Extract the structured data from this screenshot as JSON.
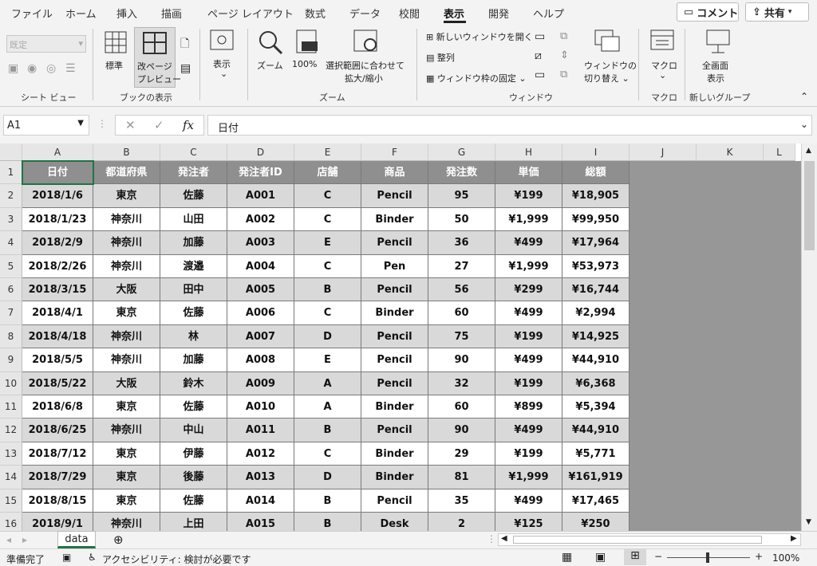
{
  "tabs": [
    "ファイル",
    "ホーム",
    "挿入",
    "描画",
    "ページ レイアウト",
    "数式",
    "データ",
    "校閲",
    "表示",
    "開発",
    "ヘルプ"
  ],
  "active_tab": "表示",
  "top_buttons": {
    "comment": "コメント",
    "share": "共有"
  },
  "ribbon": {
    "sheet_view": {
      "dropdown_value": "既定",
      "label": "シート ビュー"
    },
    "workbook_views": {
      "normal": "標準",
      "page_break_1": "改ページ",
      "page_break_2": "プレビュー",
      "label": "ブックの表示"
    },
    "show": {
      "button": "表示"
    },
    "zoom": {
      "zoom": "ズーム",
      "zoom100": "100%",
      "fit_1": "選択範囲に合わせて",
      "fit_2": "拡大/縮小",
      "label": "ズーム"
    },
    "window": {
      "new_window": "新しいウィンドウを開く",
      "arrange": "整列",
      "freeze": "ウィンドウ枠の固定",
      "switch_1": "ウィンドウの",
      "switch_2": "切り替え",
      "label": "ウィンドウ"
    },
    "macro": {
      "button": "マクロ",
      "label": "マクロ"
    },
    "new_group": {
      "btn_1": "全画面",
      "btn_2": "表示",
      "label": "新しいグループ"
    }
  },
  "formula_bar": {
    "name_box": "A1",
    "formula": "日付"
  },
  "columns": [
    "A",
    "B",
    "C",
    "D",
    "E",
    "F",
    "G",
    "H",
    "I",
    "J",
    "K",
    "L"
  ],
  "rows": [
    "1",
    "2",
    "3",
    "4",
    "5",
    "6",
    "7",
    "8",
    "9",
    "10",
    "11",
    "12",
    "13",
    "14",
    "15",
    "16"
  ],
  "table": {
    "headers": [
      "日付",
      "都道府県",
      "発注者",
      "発注者ID",
      "店舗",
      "商品",
      "発注数",
      "単価",
      "総額"
    ],
    "data": [
      [
        "2018/1/6",
        "東京",
        "佐藤",
        "A001",
        "C",
        "Pencil",
        "95",
        "¥199",
        "¥18,905"
      ],
      [
        "2018/1/23",
        "神奈川",
        "山田",
        "A002",
        "C",
        "Binder",
        "50",
        "¥1,999",
        "¥99,950"
      ],
      [
        "2018/2/9",
        "神奈川",
        "加藤",
        "A003",
        "E",
        "Pencil",
        "36",
        "¥499",
        "¥17,964"
      ],
      [
        "2018/2/26",
        "神奈川",
        "渡邉",
        "A004",
        "C",
        "Pen",
        "27",
        "¥1,999",
        "¥53,973"
      ],
      [
        "2018/3/15",
        "大阪",
        "田中",
        "A005",
        "B",
        "Pencil",
        "56",
        "¥299",
        "¥16,744"
      ],
      [
        "2018/4/1",
        "東京",
        "佐藤",
        "A006",
        "C",
        "Binder",
        "60",
        "¥499",
        "¥2,994"
      ],
      [
        "2018/4/18",
        "神奈川",
        "林",
        "A007",
        "D",
        "Pencil",
        "75",
        "¥199",
        "¥14,925"
      ],
      [
        "2018/5/5",
        "神奈川",
        "加藤",
        "A008",
        "E",
        "Pencil",
        "90",
        "¥499",
        "¥44,910"
      ],
      [
        "2018/5/22",
        "大阪",
        "鈴木",
        "A009",
        "A",
        "Pencil",
        "32",
        "¥199",
        "¥6,368"
      ],
      [
        "2018/6/8",
        "東京",
        "佐藤",
        "A010",
        "A",
        "Binder",
        "60",
        "¥899",
        "¥5,394"
      ],
      [
        "2018/6/25",
        "神奈川",
        "中山",
        "A011",
        "B",
        "Pencil",
        "90",
        "¥499",
        "¥44,910"
      ],
      [
        "2018/7/12",
        "東京",
        "伊藤",
        "A012",
        "C",
        "Binder",
        "29",
        "¥199",
        "¥5,771"
      ],
      [
        "2018/7/29",
        "東京",
        "後藤",
        "A013",
        "D",
        "Binder",
        "81",
        "¥1,999",
        "¥161,919"
      ],
      [
        "2018/8/15",
        "東京",
        "佐藤",
        "A014",
        "B",
        "Pencil",
        "35",
        "¥499",
        "¥17,465"
      ],
      [
        "2018/9/1",
        "神奈川",
        "上田",
        "A015",
        "B",
        "Desk",
        "2",
        "¥125",
        "¥250"
      ]
    ]
  },
  "sheet_tab": "data",
  "status": {
    "ready": "準備完了",
    "accessibility": "アクセシビリティ: 検討が必要です",
    "zoom": "100%"
  },
  "colors": {
    "header_fill": "#8f8f8f",
    "odd_row": "#d9d9d9",
    "page_break_gray": "#979797"
  }
}
